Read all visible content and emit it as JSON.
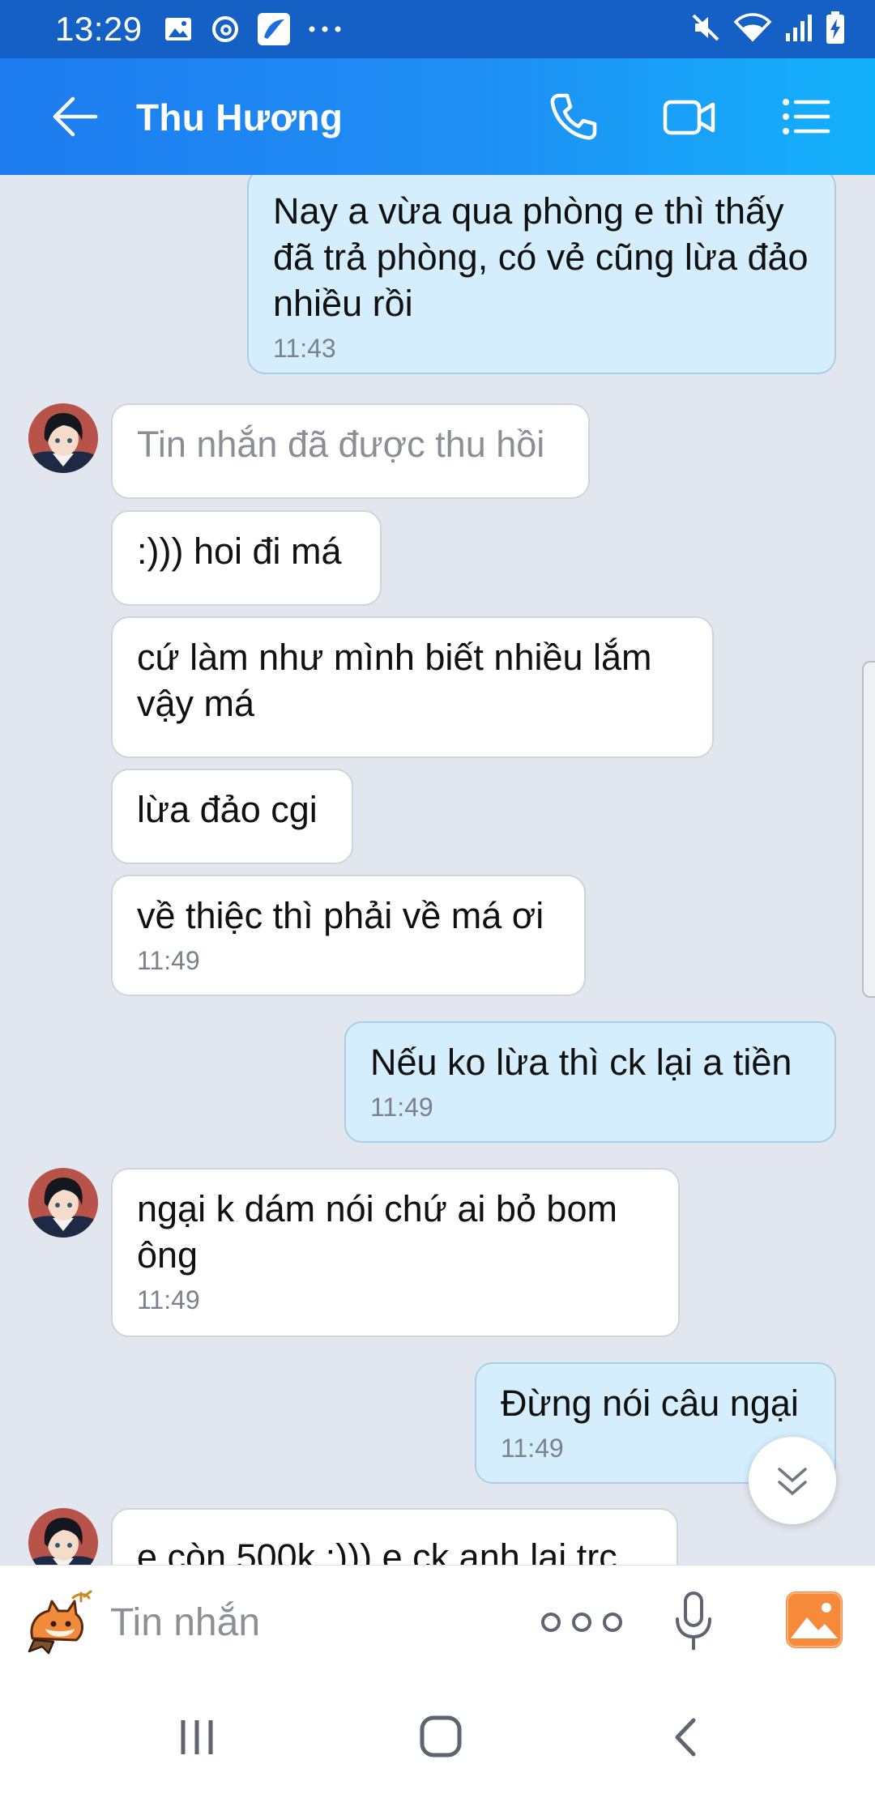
{
  "status_bar": {
    "time": "13:29",
    "left_icons": [
      "gallery-icon",
      "threads-icon",
      "vnpt-app-icon",
      "more-notifications-icon"
    ],
    "right_icons": [
      "mute-icon",
      "wifi-icon",
      "signal-icon",
      "battery-charging-icon"
    ]
  },
  "header": {
    "title": "Thu Hương",
    "accent_color": "#1e7cf0"
  },
  "messages": [
    {
      "direction": "out",
      "text": "Nay a vừa qua phòng e thì thấy đã trả phòng, có vẻ cũng lừa đảo nhiều rồi",
      "time": "11:43"
    },
    {
      "direction": "in",
      "text": "Tin nhắn đã được thu hồi",
      "recalled": true
    },
    {
      "direction": "in",
      "text": ":))) hoi đi má"
    },
    {
      "direction": "in",
      "text": "cứ làm như mình biết nhiều lắm vậy má"
    },
    {
      "direction": "in",
      "text": "lừa đảo cgi"
    },
    {
      "direction": "in",
      "text": "về thiệc thì phải về má ơi",
      "time": "11:49"
    },
    {
      "direction": "out",
      "text": "Nếu ko lừa thì ck lại a tiền",
      "time": "11:49"
    },
    {
      "direction": "in",
      "text": "ngại k dám nói chứ ai bỏ bom ông",
      "time": "11:49"
    },
    {
      "direction": "out",
      "text": "Đừng nói câu ngại",
      "time": "11:49"
    },
    {
      "direction": "in",
      "text": "e còn 500k :))) e ck anh lại trc"
    }
  ],
  "composer": {
    "placeholder": "Tin nhắn",
    "icons": [
      "sticker-icon",
      "more-dots-icon",
      "microphone-icon",
      "image-gallery-icon"
    ]
  },
  "nav_bar": {
    "icons": [
      "recents-icon",
      "home-icon",
      "back-icon"
    ]
  },
  "colors": {
    "outgoing_bubble": "#d5eefd",
    "incoming_bubble": "#ffffff",
    "chat_background": "#e2e6ee",
    "gallery_icon": "#f78a3a"
  }
}
